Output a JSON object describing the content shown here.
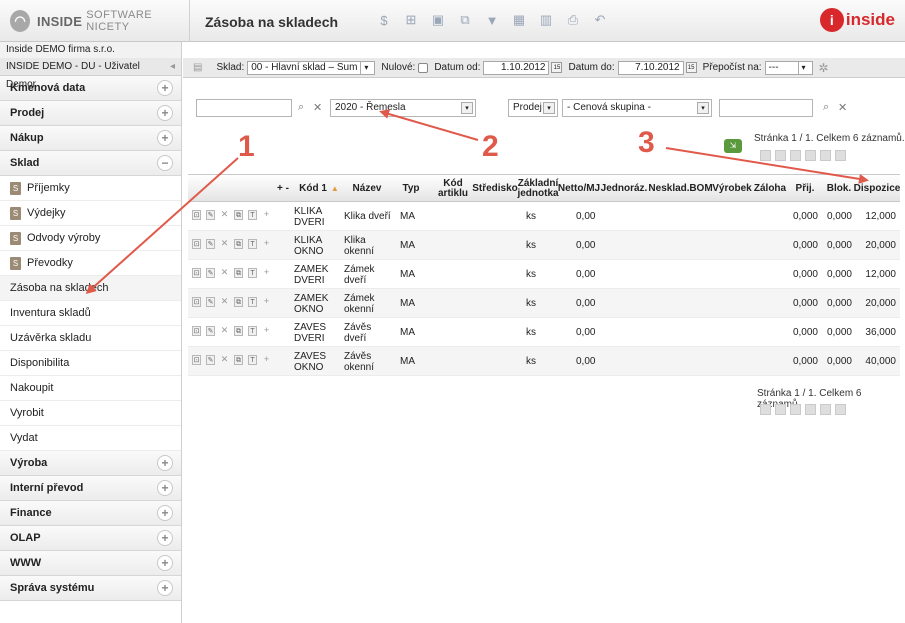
{
  "header": {
    "logo_text": "INSIDE",
    "logo_sub": "SOFTWARE NICETY",
    "page_title": "Zásoba na skladech",
    "toolbar_icons": [
      "refresh-icon",
      "add-icon",
      "edit-icon",
      "copy-icon",
      "filter-icon",
      "export-icon",
      "chart-icon",
      "print-icon",
      "undo-icon"
    ],
    "brand": "inside",
    "brand_logo_letter": "i"
  },
  "sidebar": {
    "company": "Inside DEMO firma s.r.o.",
    "user": "INSIDE DEMO - DU - Uživatel Demor",
    "sections_top": [
      {
        "label": "Kmenová data",
        "toggle": "+"
      },
      {
        "label": "Prodej",
        "toggle": "+"
      },
      {
        "label": "Nákup",
        "toggle": "+"
      },
      {
        "label": "Sklad",
        "toggle": "−"
      }
    ],
    "sklad_items": [
      {
        "label": "Příjemky",
        "icon": "S"
      },
      {
        "label": "Výdejky",
        "icon": "S"
      },
      {
        "label": "Odvody výroby",
        "icon": "S"
      },
      {
        "label": "Převodky",
        "icon": "S"
      },
      {
        "label": "Zásoba na skladech"
      },
      {
        "label": "Inventura skladů"
      },
      {
        "label": "Uzávěrka skladu"
      },
      {
        "label": "Disponibilita"
      },
      {
        "label": "Nakoupit"
      },
      {
        "label": "Vyrobit"
      },
      {
        "label": "Vydat"
      }
    ],
    "sections_bottom": [
      {
        "label": "Výroba",
        "toggle": "+"
      },
      {
        "label": "Interní převod",
        "toggle": "+"
      },
      {
        "label": "Finance",
        "toggle": "+"
      },
      {
        "label": "OLAP",
        "toggle": "+"
      },
      {
        "label": "WWW",
        "toggle": "+"
      },
      {
        "label": "Správa systému",
        "toggle": "+"
      }
    ]
  },
  "filterbar": {
    "sklad_label": "Sklad:",
    "sklad_value": "00 - Hlavní sklad – Sum",
    "nulove_label": "Nulové:",
    "datum_od_label": "Datum od:",
    "datum_od_value": "1.10.2012",
    "datum_do_label": "Datum do:",
    "datum_do_value": "7.10.2012",
    "prepocist_label": "Přepočíst na:",
    "prepocist_value": "---",
    "cal_text": "15"
  },
  "search": {
    "text_value": "",
    "group_value": "2020 - Řemesla",
    "price_type": "Prodej",
    "price_group": "- Cenová skupina -",
    "search2_value": ""
  },
  "paging": {
    "top": "Stránka 1 / 1. Celkem 6 záznamů.",
    "bottom": "Stránka 1 / 1. Celkem 6 záznamů."
  },
  "table": {
    "headers": {
      "plusminus": "+ -",
      "kod": "Kód 1",
      "nazev": "Název",
      "typ": "Typ",
      "kod_artiklu": "Kód artiklu",
      "stredisko": "Středisko",
      "zakl_jednotka": "Základní jednotka",
      "netto": "Netto/MJ",
      "jednoraz": "Jednoráz.",
      "nesklad": "Nesklad.",
      "bom": "BOM",
      "vyrobek": "Výrobek",
      "zaloha": "Záloha",
      "prij": "Přij.",
      "blok": "Blok.",
      "dispozice": "Dispozice"
    },
    "rows": [
      {
        "kod": "KLIKA DVERI",
        "nazev": "Klika dveří",
        "typ": "MA",
        "jednotka": "ks",
        "netto": "0,00",
        "prij": "0,000",
        "blok": "0,000",
        "dispozice": "12,000"
      },
      {
        "kod": "KLIKA OKNO",
        "nazev": "Klika okenní",
        "typ": "MA",
        "jednotka": "ks",
        "netto": "0,00",
        "prij": "0,000",
        "blok": "0,000",
        "dispozice": "20,000"
      },
      {
        "kod": "ZAMEK DVERI",
        "nazev": "Zámek dveří",
        "typ": "MA",
        "jednotka": "ks",
        "netto": "0,00",
        "prij": "0,000",
        "blok": "0,000",
        "dispozice": "12,000"
      },
      {
        "kod": "ZAMEK OKNO",
        "nazev": "Zámek okenní",
        "typ": "MA",
        "jednotka": "ks",
        "netto": "0,00",
        "prij": "0,000",
        "blok": "0,000",
        "dispozice": "20,000"
      },
      {
        "kod": "ZAVES DVERI",
        "nazev": "Závěs dveří",
        "typ": "MA",
        "jednotka": "ks",
        "netto": "0,00",
        "prij": "0,000",
        "blok": "0,000",
        "dispozice": "36,000"
      },
      {
        "kod": "ZAVES OKNO",
        "nazev": "Závěs okenní",
        "typ": "MA",
        "jednotka": "ks",
        "netto": "0,00",
        "prij": "0,000",
        "blok": "0,000",
        "dispozice": "40,000"
      }
    ]
  },
  "annotations": {
    "one": "1",
    "two": "2",
    "three": "3",
    "color": "#e05a4b"
  }
}
